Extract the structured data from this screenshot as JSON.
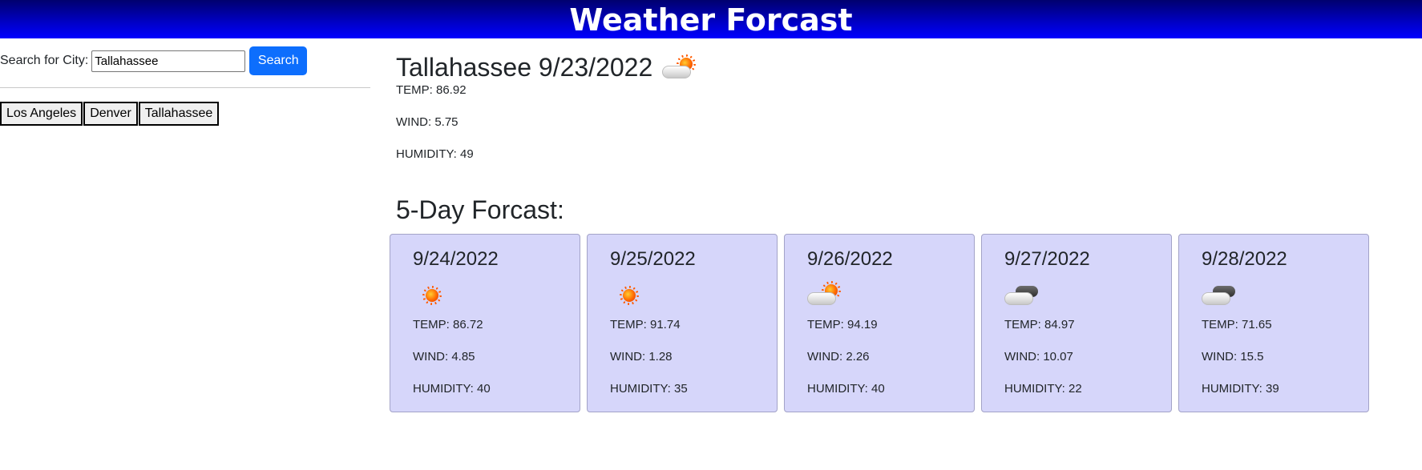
{
  "header": {
    "title": "Weather Forcast"
  },
  "search": {
    "label": "Search for City:",
    "value": "Tallahassee",
    "button_label": "Search"
  },
  "history": [
    "Los Angeles",
    "Denver",
    "Tallahassee"
  ],
  "current": {
    "title": "Tallahassee 9/23/2022",
    "icon": "few-clouds-icon",
    "temp": "TEMP: 86.92",
    "wind": "WIND: 5.75",
    "humidity": "HUMIDITY: 49"
  },
  "forecast": {
    "title": "5-Day Forcast:",
    "days": [
      {
        "date": "9/24/2022",
        "icon": "clear-sky-icon",
        "temp": "TEMP: 86.72",
        "wind": "WIND: 4.85",
        "humidity": "HUMIDITY: 40"
      },
      {
        "date": "9/25/2022",
        "icon": "clear-sky-icon",
        "temp": "TEMP: 91.74",
        "wind": "WIND: 1.28",
        "humidity": "HUMIDITY: 35"
      },
      {
        "date": "9/26/2022",
        "icon": "few-clouds-icon",
        "temp": "TEMP: 94.19",
        "wind": "WIND: 2.26",
        "humidity": "HUMIDITY: 40"
      },
      {
        "date": "9/27/2022",
        "icon": "broken-clouds-icon",
        "temp": "TEMP: 84.97",
        "wind": "WIND: 10.07",
        "humidity": "HUMIDITY: 22"
      },
      {
        "date": "9/28/2022",
        "icon": "broken-clouds-icon",
        "temp": "TEMP: 71.65",
        "wind": "WIND: 15.5",
        "humidity": "HUMIDITY: 39"
      }
    ]
  },
  "colors": {
    "header_gradient_top": "#00006e",
    "header_gradient_bottom": "#0000ff",
    "search_button": "#0d6efd",
    "card_background": "#d6d6fa"
  }
}
